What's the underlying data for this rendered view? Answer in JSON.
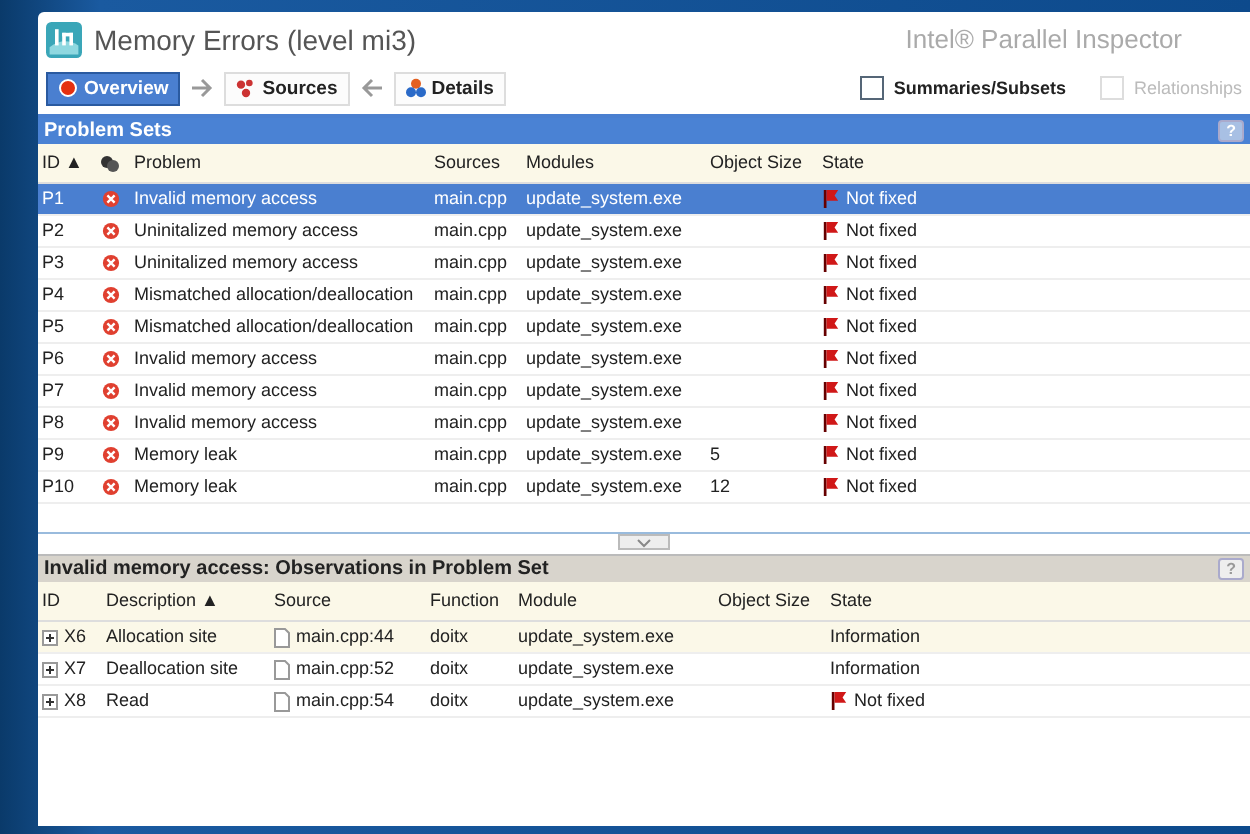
{
  "window": {
    "title": "Memory Errors (level mi3)",
    "product": "Intel® Parallel Inspector"
  },
  "nav": [
    {
      "label": "Overview",
      "selected": true
    },
    {
      "label": "Sources",
      "selected": false
    },
    {
      "label": "Details",
      "selected": false
    }
  ],
  "options": [
    {
      "label": "Summaries/Subsets",
      "checked": false,
      "disabled": false
    },
    {
      "label": "Relationships",
      "checked": false,
      "disabled": true
    }
  ],
  "problem_sets": {
    "title": "Problem Sets",
    "help": "?",
    "columns": [
      "ID ▲",
      "Problem",
      "Sources",
      "Modules",
      "Object Size",
      "State"
    ],
    "rows": [
      {
        "id": "P1",
        "problem": "Invalid memory access",
        "sources": "main.cpp",
        "modules": "update_system.exe",
        "object_size": "",
        "state": "Not fixed",
        "selected": true
      },
      {
        "id": "P2",
        "problem": "Uninitalized memory access",
        "sources": "main.cpp",
        "modules": "update_system.exe",
        "object_size": "",
        "state": "Not fixed",
        "selected": false
      },
      {
        "id": "P3",
        "problem": "Uninitalized memory access",
        "sources": "main.cpp",
        "modules": "update_system.exe",
        "object_size": "",
        "state": "Not fixed",
        "selected": false
      },
      {
        "id": "P4",
        "problem": "Mismatched allocation/deallocation",
        "sources": "main.cpp",
        "modules": "update_system.exe",
        "object_size": "",
        "state": "Not fixed",
        "selected": false
      },
      {
        "id": "P5",
        "problem": "Mismatched allocation/deallocation",
        "sources": "main.cpp",
        "modules": "update_system.exe",
        "object_size": "",
        "state": "Not fixed",
        "selected": false
      },
      {
        "id": "P6",
        "problem": "Invalid memory access",
        "sources": "main.cpp",
        "modules": "update_system.exe",
        "object_size": "",
        "state": "Not fixed",
        "selected": false
      },
      {
        "id": "P7",
        "problem": "Invalid memory access",
        "sources": "main.cpp",
        "modules": "update_system.exe",
        "object_size": "",
        "state": "Not fixed",
        "selected": false
      },
      {
        "id": "P8",
        "problem": "Invalid memory access",
        "sources": "main.cpp",
        "modules": "update_system.exe",
        "object_size": "",
        "state": "Not fixed",
        "selected": false
      },
      {
        "id": "P9",
        "problem": "Memory leak",
        "sources": "main.cpp",
        "modules": "update_system.exe",
        "object_size": "5",
        "state": "Not fixed",
        "selected": false
      },
      {
        "id": "P10",
        "problem": "Memory leak",
        "sources": "main.cpp",
        "modules": "update_system.exe",
        "object_size": "12",
        "state": "Not fixed",
        "selected": false
      }
    ]
  },
  "observations": {
    "title": "Invalid memory access: Observations in Problem Set",
    "help": "?",
    "columns": [
      "ID",
      "Description ▲",
      "Source",
      "Function",
      "Module",
      "Object Size",
      "State"
    ],
    "rows": [
      {
        "id": "X6",
        "description": "Allocation site",
        "source": "main.cpp:44",
        "function": "doitx",
        "module": "update_system.exe",
        "state": "Information",
        "flagged": false,
        "selected": true
      },
      {
        "id": "X7",
        "description": "Deallocation site",
        "source": "main.cpp:52",
        "function": "doitx",
        "module": "update_system.exe",
        "state": "Information",
        "flagged": false,
        "selected": false
      },
      {
        "id": "X8",
        "description": "Read",
        "source": "main.cpp:54",
        "function": "doitx",
        "module": "update_system.exe",
        "state": "Not fixed",
        "flagged": true,
        "selected": false
      }
    ]
  }
}
